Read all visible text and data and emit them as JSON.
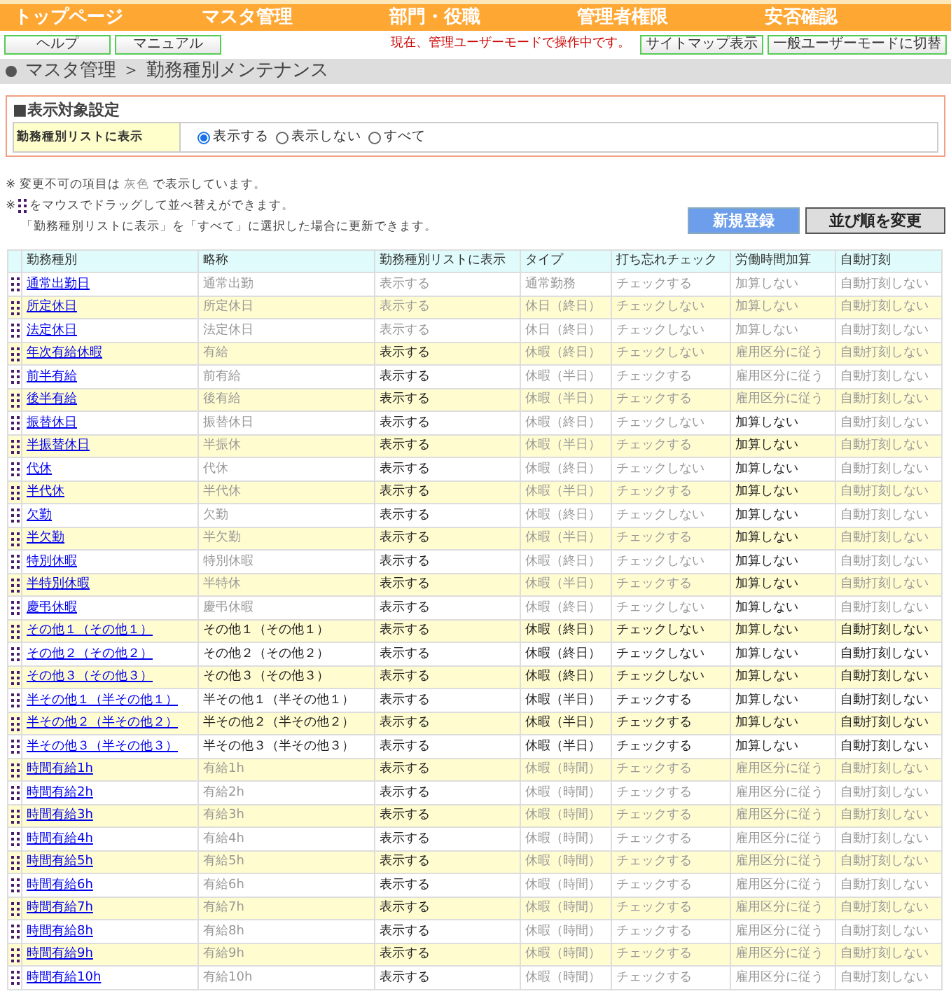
{
  "nav": [
    "トップページ",
    "マスタ管理",
    "部門・役職",
    "管理者権限",
    "安否確認"
  ],
  "left_buttons": [
    "ヘルプ",
    "マニュアル"
  ],
  "mode_message": "現在、管理ユーザーモードで操作中です。",
  "right_buttons": [
    "サイトマップ表示",
    "一般ユーザーモードに切替"
  ],
  "breadcrumb": "マスタ管理 ＞ 勤務種別メンテナンス",
  "filter": {
    "title": "■表示対象設定",
    "label": "勤務種別リストに表示",
    "options": [
      {
        "label": "表示する",
        "selected": true
      },
      {
        "label": "表示しない",
        "selected": false
      },
      {
        "label": "すべて",
        "selected": false
      }
    ]
  },
  "notes": {
    "line1": {
      "before": "※ 変更不可の項目は ",
      "gray": "灰色",
      "after": " で表示しています。"
    },
    "line2_mark": "※",
    "line2": "をマウスでドラッグして並べ替えができます。",
    "line3": "「勤務種別リストに表示」を「すべて」に選択した場合に更新できます。"
  },
  "actions": {
    "new": "新規登録",
    "reorder": "並び順を変更"
  },
  "table": {
    "columns": [
      "勤務種別",
      "略称",
      "勤務種別リストに表示",
      "タイプ",
      "打ち忘れチェック",
      "労働時間加算",
      "自動打刻"
    ],
    "rows": [
      {
        "cells": [
          {
            "kind": "link",
            "text": "通常出勤日"
          },
          {
            "text": "通常出勤",
            "muted": true
          },
          {
            "text": "表示する",
            "muted": true
          },
          {
            "text": "通常勤務",
            "muted": true
          },
          {
            "text": "チェックする",
            "muted": true
          },
          {
            "text": "加算しない",
            "muted": true
          },
          {
            "text": "自動打刻しない",
            "muted": true
          }
        ]
      },
      {
        "cells": [
          {
            "kind": "link",
            "text": "所定休日"
          },
          {
            "text": "所定休日",
            "muted": true
          },
          {
            "text": "表示する",
            "muted": true
          },
          {
            "text": "休日（終日）",
            "muted": true
          },
          {
            "text": "チェックしない",
            "muted": true
          },
          {
            "text": "加算しない",
            "muted": true
          },
          {
            "text": "自動打刻しない",
            "muted": true
          }
        ]
      },
      {
        "cells": [
          {
            "kind": "link",
            "text": "法定休日"
          },
          {
            "text": "法定休日",
            "muted": true
          },
          {
            "text": "表示する",
            "muted": true
          },
          {
            "text": "休日（終日）",
            "muted": true
          },
          {
            "text": "チェックしない",
            "muted": true
          },
          {
            "text": "加算しない",
            "muted": true
          },
          {
            "text": "自動打刻しない",
            "muted": true
          }
        ]
      },
      {
        "cells": [
          {
            "kind": "link",
            "text": "年次有給休暇"
          },
          {
            "text": "有給",
            "muted": true
          },
          {
            "text": "表示する",
            "muted": false
          },
          {
            "text": "休暇（終日）",
            "muted": true
          },
          {
            "text": "チェックしない",
            "muted": true
          },
          {
            "text": "雇用区分に従う",
            "muted": true
          },
          {
            "text": "自動打刻しない",
            "muted": true
          }
        ]
      },
      {
        "cells": [
          {
            "kind": "link",
            "text": "前半有給"
          },
          {
            "text": "前有給",
            "muted": true
          },
          {
            "text": "表示する",
            "muted": false
          },
          {
            "text": "休暇（半日）",
            "muted": true
          },
          {
            "text": "チェックする",
            "muted": true
          },
          {
            "text": "雇用区分に従う",
            "muted": true
          },
          {
            "text": "自動打刻しない",
            "muted": true
          }
        ]
      },
      {
        "cells": [
          {
            "kind": "link",
            "text": "後半有給"
          },
          {
            "text": "後有給",
            "muted": true
          },
          {
            "text": "表示する",
            "muted": false
          },
          {
            "text": "休暇（半日）",
            "muted": true
          },
          {
            "text": "チェックする",
            "muted": true
          },
          {
            "text": "雇用区分に従う",
            "muted": true
          },
          {
            "text": "自動打刻しない",
            "muted": true
          }
        ]
      },
      {
        "cells": [
          {
            "kind": "link",
            "text": "振替休日"
          },
          {
            "text": "振替休日",
            "muted": true
          },
          {
            "text": "表示する",
            "muted": false
          },
          {
            "text": "休暇（終日）",
            "muted": true
          },
          {
            "text": "チェックしない",
            "muted": true
          },
          {
            "text": "加算しない",
            "muted": false
          },
          {
            "text": "自動打刻しない",
            "muted": true
          }
        ]
      },
      {
        "cells": [
          {
            "kind": "link",
            "text": "半振替休日"
          },
          {
            "text": "半振休",
            "muted": true
          },
          {
            "text": "表示する",
            "muted": false
          },
          {
            "text": "休暇（半日）",
            "muted": true
          },
          {
            "text": "チェックする",
            "muted": true
          },
          {
            "text": "加算しない",
            "muted": false
          },
          {
            "text": "自動打刻しない",
            "muted": true
          }
        ]
      },
      {
        "cells": [
          {
            "kind": "link",
            "text": "代休"
          },
          {
            "text": "代休",
            "muted": true
          },
          {
            "text": "表示する",
            "muted": false
          },
          {
            "text": "休暇（終日）",
            "muted": true
          },
          {
            "text": "チェックしない",
            "muted": true
          },
          {
            "text": "加算しない",
            "muted": false
          },
          {
            "text": "自動打刻しない",
            "muted": true
          }
        ]
      },
      {
        "cells": [
          {
            "kind": "link",
            "text": "半代休"
          },
          {
            "text": "半代休",
            "muted": true
          },
          {
            "text": "表示する",
            "muted": false
          },
          {
            "text": "休暇（半日）",
            "muted": true
          },
          {
            "text": "チェックする",
            "muted": true
          },
          {
            "text": "加算しない",
            "muted": false
          },
          {
            "text": "自動打刻しない",
            "muted": true
          }
        ]
      },
      {
        "cells": [
          {
            "kind": "link",
            "text": "欠勤"
          },
          {
            "text": "欠勤",
            "muted": true
          },
          {
            "text": "表示する",
            "muted": false
          },
          {
            "text": "休暇（終日）",
            "muted": true
          },
          {
            "text": "チェックしない",
            "muted": true
          },
          {
            "text": "加算しない",
            "muted": false
          },
          {
            "text": "自動打刻しない",
            "muted": true
          }
        ]
      },
      {
        "cells": [
          {
            "kind": "link",
            "text": "半欠勤"
          },
          {
            "text": "半欠勤",
            "muted": true
          },
          {
            "text": "表示する",
            "muted": false
          },
          {
            "text": "休暇（半日）",
            "muted": true
          },
          {
            "text": "チェックする",
            "muted": true
          },
          {
            "text": "加算しない",
            "muted": false
          },
          {
            "text": "自動打刻しない",
            "muted": true
          }
        ]
      },
      {
        "cells": [
          {
            "kind": "link",
            "text": "特別休暇"
          },
          {
            "text": "特別休暇",
            "muted": true
          },
          {
            "text": "表示する",
            "muted": false
          },
          {
            "text": "休暇（終日）",
            "muted": true
          },
          {
            "text": "チェックしない",
            "muted": true
          },
          {
            "text": "加算しない",
            "muted": false
          },
          {
            "text": "自動打刻しない",
            "muted": true
          }
        ]
      },
      {
        "cells": [
          {
            "kind": "link",
            "text": "半特別休暇"
          },
          {
            "text": "半特休",
            "muted": true
          },
          {
            "text": "表示する",
            "muted": false
          },
          {
            "text": "休暇（半日）",
            "muted": true
          },
          {
            "text": "チェックする",
            "muted": true
          },
          {
            "text": "加算しない",
            "muted": false
          },
          {
            "text": "自動打刻しない",
            "muted": true
          }
        ]
      },
      {
        "cells": [
          {
            "kind": "link",
            "text": "慶弔休暇"
          },
          {
            "text": "慶弔休暇",
            "muted": true
          },
          {
            "text": "表示する",
            "muted": false
          },
          {
            "text": "休暇（終日）",
            "muted": true
          },
          {
            "text": "チェックしない",
            "muted": true
          },
          {
            "text": "加算しない",
            "muted": false
          },
          {
            "text": "自動打刻しない",
            "muted": true
          }
        ]
      },
      {
        "cells": [
          {
            "kind": "link",
            "text": "その他１（その他１）"
          },
          {
            "text": "その他１（その他１）",
            "muted": false
          },
          {
            "text": "表示する",
            "muted": false
          },
          {
            "text": "休暇（終日）",
            "muted": false
          },
          {
            "text": "チェックしない",
            "muted": false
          },
          {
            "text": "加算しない",
            "muted": false
          },
          {
            "text": "自動打刻しない",
            "muted": false
          }
        ]
      },
      {
        "cells": [
          {
            "kind": "link",
            "text": "その他２（その他２）"
          },
          {
            "text": "その他２（その他２）",
            "muted": false
          },
          {
            "text": "表示する",
            "muted": false
          },
          {
            "text": "休暇（終日）",
            "muted": false
          },
          {
            "text": "チェックしない",
            "muted": false
          },
          {
            "text": "加算しない",
            "muted": false
          },
          {
            "text": "自動打刻しない",
            "muted": false
          }
        ]
      },
      {
        "cells": [
          {
            "kind": "link",
            "text": "その他３（その他３）"
          },
          {
            "text": "その他３（その他３）",
            "muted": false
          },
          {
            "text": "表示する",
            "muted": false
          },
          {
            "text": "休暇（終日）",
            "muted": false
          },
          {
            "text": "チェックしない",
            "muted": false
          },
          {
            "text": "加算しない",
            "muted": false
          },
          {
            "text": "自動打刻しない",
            "muted": false
          }
        ]
      },
      {
        "cells": [
          {
            "kind": "link",
            "text": "半その他１（半その他１）"
          },
          {
            "text": "半その他１（半その他１）",
            "muted": false
          },
          {
            "text": "表示する",
            "muted": false
          },
          {
            "text": "休暇（半日）",
            "muted": false
          },
          {
            "text": "チェックする",
            "muted": false
          },
          {
            "text": "加算しない",
            "muted": false
          },
          {
            "text": "自動打刻しない",
            "muted": false
          }
        ]
      },
      {
        "cells": [
          {
            "kind": "link",
            "text": "半その他２（半その他２）"
          },
          {
            "text": "半その他２（半その他２）",
            "muted": false
          },
          {
            "text": "表示する",
            "muted": false
          },
          {
            "text": "休暇（半日）",
            "muted": false
          },
          {
            "text": "チェックする",
            "muted": false
          },
          {
            "text": "加算しない",
            "muted": false
          },
          {
            "text": "自動打刻しない",
            "muted": false
          }
        ]
      },
      {
        "cells": [
          {
            "kind": "link",
            "text": "半その他３（半その他３）"
          },
          {
            "text": "半その他３（半その他３）",
            "muted": false
          },
          {
            "text": "表示する",
            "muted": false
          },
          {
            "text": "休暇（半日）",
            "muted": false
          },
          {
            "text": "チェックする",
            "muted": false
          },
          {
            "text": "加算しない",
            "muted": false
          },
          {
            "text": "自動打刻しない",
            "muted": false
          }
        ]
      },
      {
        "cells": [
          {
            "kind": "link",
            "text": "時間有給1h"
          },
          {
            "text": "有給1h",
            "muted": true
          },
          {
            "text": "表示する",
            "muted": false
          },
          {
            "text": "休暇（時間）",
            "muted": true
          },
          {
            "text": "チェックする",
            "muted": true
          },
          {
            "text": "雇用区分に従う",
            "muted": true
          },
          {
            "text": "自動打刻しない",
            "muted": true
          }
        ]
      },
      {
        "cells": [
          {
            "kind": "link",
            "text": "時間有給2h"
          },
          {
            "text": "有給2h",
            "muted": true
          },
          {
            "text": "表示する",
            "muted": false
          },
          {
            "text": "休暇（時間）",
            "muted": true
          },
          {
            "text": "チェックする",
            "muted": true
          },
          {
            "text": "雇用区分に従う",
            "muted": true
          },
          {
            "text": "自動打刻しない",
            "muted": true
          }
        ]
      },
      {
        "cells": [
          {
            "kind": "link",
            "text": "時間有給3h"
          },
          {
            "text": "有給3h",
            "muted": true
          },
          {
            "text": "表示する",
            "muted": false
          },
          {
            "text": "休暇（時間）",
            "muted": true
          },
          {
            "text": "チェックする",
            "muted": true
          },
          {
            "text": "雇用区分に従う",
            "muted": true
          },
          {
            "text": "自動打刻しない",
            "muted": true
          }
        ]
      },
      {
        "cells": [
          {
            "kind": "link",
            "text": "時間有給4h"
          },
          {
            "text": "有給4h",
            "muted": true
          },
          {
            "text": "表示する",
            "muted": false
          },
          {
            "text": "休暇（時間）",
            "muted": true
          },
          {
            "text": "チェックする",
            "muted": true
          },
          {
            "text": "雇用区分に従う",
            "muted": true
          },
          {
            "text": "自動打刻しない",
            "muted": true
          }
        ]
      },
      {
        "cells": [
          {
            "kind": "link",
            "text": "時間有給5h"
          },
          {
            "text": "有給5h",
            "muted": true
          },
          {
            "text": "表示する",
            "muted": false
          },
          {
            "text": "休暇（時間）",
            "muted": true
          },
          {
            "text": "チェックする",
            "muted": true
          },
          {
            "text": "雇用区分に従う",
            "muted": true
          },
          {
            "text": "自動打刻しない",
            "muted": true
          }
        ]
      },
      {
        "cells": [
          {
            "kind": "link",
            "text": "時間有給6h"
          },
          {
            "text": "有給6h",
            "muted": true
          },
          {
            "text": "表示する",
            "muted": false
          },
          {
            "text": "休暇（時間）",
            "muted": true
          },
          {
            "text": "チェックする",
            "muted": true
          },
          {
            "text": "雇用区分に従う",
            "muted": true
          },
          {
            "text": "自動打刻しない",
            "muted": true
          }
        ]
      },
      {
        "cells": [
          {
            "kind": "link",
            "text": "時間有給7h"
          },
          {
            "text": "有給7h",
            "muted": true
          },
          {
            "text": "表示する",
            "muted": false
          },
          {
            "text": "休暇（時間）",
            "muted": true
          },
          {
            "text": "チェックする",
            "muted": true
          },
          {
            "text": "雇用区分に従う",
            "muted": true
          },
          {
            "text": "自動打刻しない",
            "muted": true
          }
        ]
      },
      {
        "cells": [
          {
            "kind": "link",
            "text": "時間有給8h"
          },
          {
            "text": "有給8h",
            "muted": true
          },
          {
            "text": "表示する",
            "muted": false
          },
          {
            "text": "休暇（時間）",
            "muted": true
          },
          {
            "text": "チェックする",
            "muted": true
          },
          {
            "text": "雇用区分に従う",
            "muted": true
          },
          {
            "text": "自動打刻しない",
            "muted": true
          }
        ]
      },
      {
        "cells": [
          {
            "kind": "link",
            "text": "時間有給9h"
          },
          {
            "text": "有給9h",
            "muted": true
          },
          {
            "text": "表示する",
            "muted": false
          },
          {
            "text": "休暇（時間）",
            "muted": true
          },
          {
            "text": "チェックする",
            "muted": true
          },
          {
            "text": "雇用区分に従う",
            "muted": true
          },
          {
            "text": "自動打刻しない",
            "muted": true
          }
        ]
      },
      {
        "cells": [
          {
            "kind": "link",
            "text": "時間有給10h"
          },
          {
            "text": "有給10h",
            "muted": true
          },
          {
            "text": "表示する",
            "muted": false
          },
          {
            "text": "休暇（時間）",
            "muted": true
          },
          {
            "text": "チェックする",
            "muted": true
          },
          {
            "text": "雇用区分に従う",
            "muted": true
          },
          {
            "text": "自動打刻しない",
            "muted": true
          }
        ]
      }
    ]
  }
}
